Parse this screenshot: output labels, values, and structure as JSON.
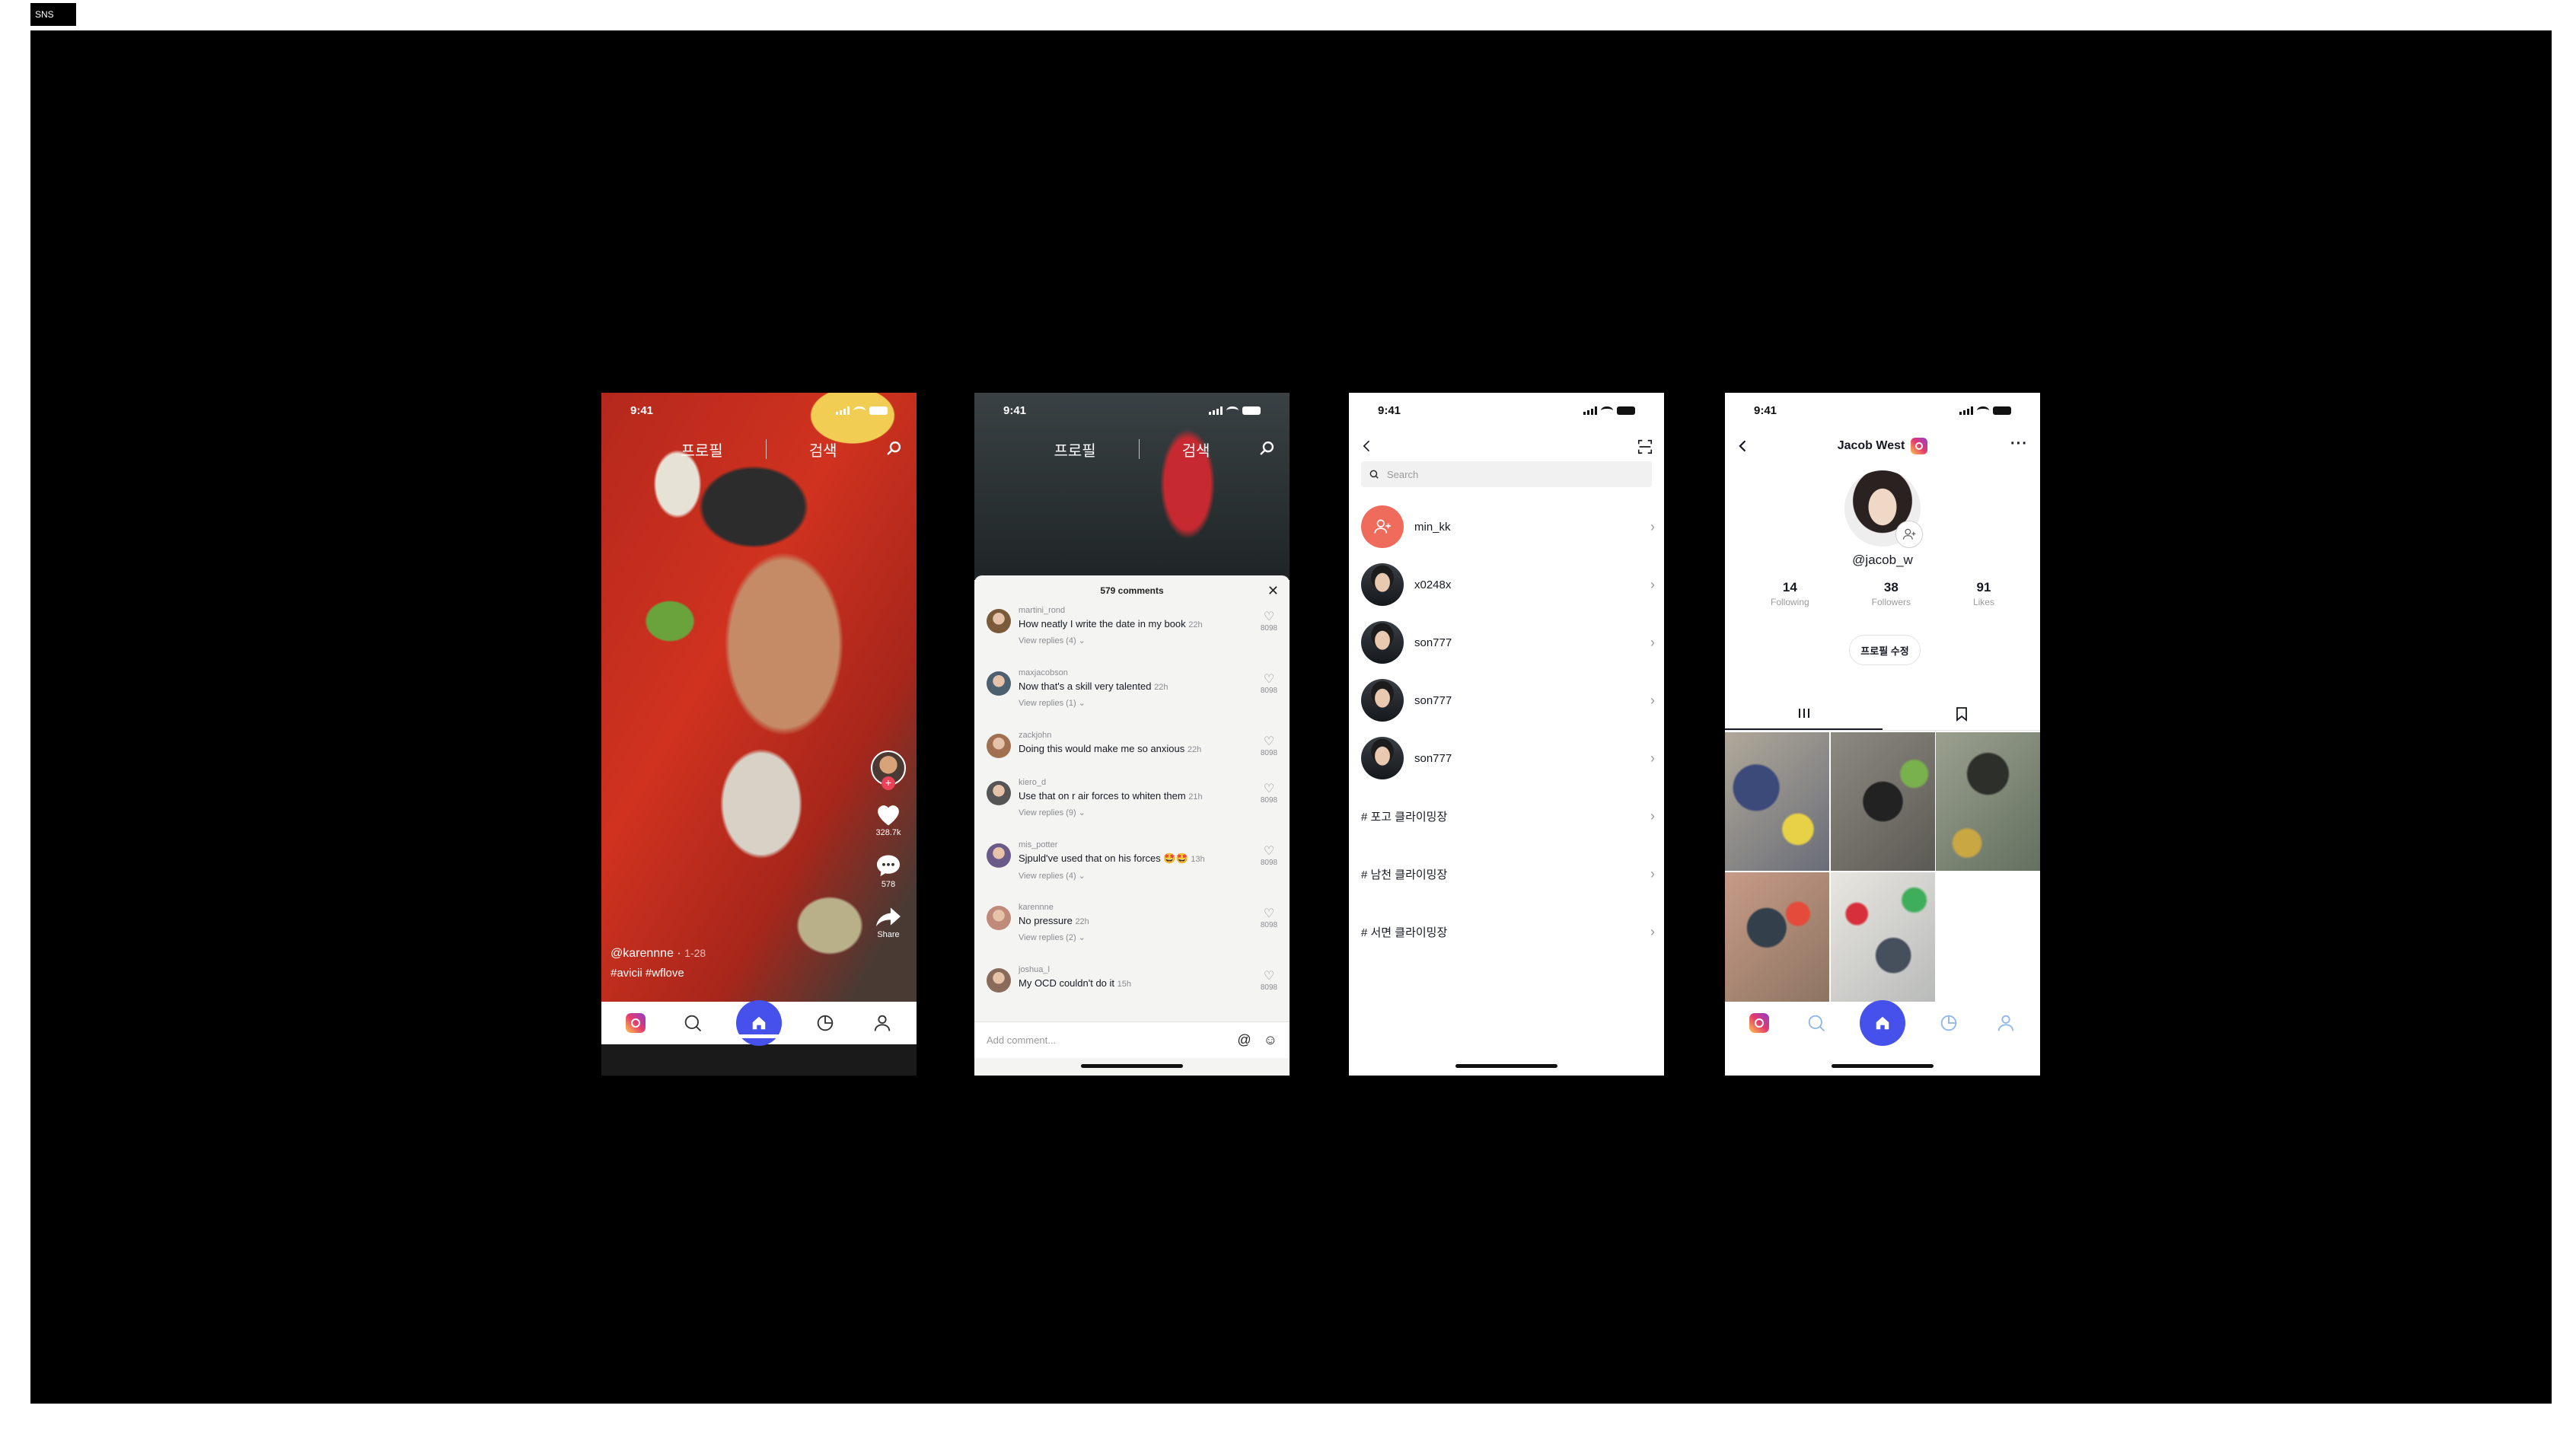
{
  "frame_label": "SNS",
  "status_time": "9:41",
  "feed": {
    "tabs": [
      "프로필",
      "검색"
    ],
    "username": "@karennne",
    "duration": "1-28",
    "hashtags": "#avicii #wflove",
    "likes": "328.7k",
    "comments": "578",
    "share": "Share"
  },
  "comments_sheet": {
    "tabs": [
      "프로필",
      "검색"
    ],
    "title": "579 comments",
    "add_placeholder": "Add comment...",
    "items": [
      {
        "user": "martini_rond",
        "text": "How neatly I write the date in my book",
        "ago": "22h",
        "replies": "View replies (4)",
        "likes": "8098",
        "color": "#7a5a3a"
      },
      {
        "user": "maxjacobson",
        "text": "Now that's a skill very talented",
        "ago": "22h",
        "replies": "View replies (1)",
        "likes": "8098",
        "color": "#4d6070"
      },
      {
        "user": "zackjohn",
        "text": "Doing this would make me so anxious",
        "ago": "22h",
        "replies": "",
        "likes": "8098",
        "color": "#a07050"
      },
      {
        "user": "kiero_d",
        "text": "Use that on r air forces to whiten them",
        "ago": "21h",
        "replies": "View replies (9)",
        "likes": "8098",
        "color": "#555555"
      },
      {
        "user": "mis_potter",
        "text": "Sjpuld've used that on his forces 🤩🤩",
        "ago": "13h",
        "replies": "View replies (4)",
        "likes": "8098",
        "color": "#6a5a8a"
      },
      {
        "user": "karennne",
        "text": "No pressure",
        "ago": "22h",
        "replies": "View replies (2)",
        "likes": "8098",
        "color": "#c08a7a"
      },
      {
        "user": "joshua_l",
        "text": "My OCD couldn't do it",
        "ago": "15h",
        "replies": "",
        "likes": "8098",
        "color": "#8a6a5a"
      }
    ]
  },
  "search": {
    "placeholder": "Search",
    "rows": [
      {
        "label": "min_kk",
        "kind": "add-user"
      },
      {
        "label": "x0248x",
        "kind": "user"
      },
      {
        "label": "son777",
        "kind": "user"
      },
      {
        "label": "son777",
        "kind": "user"
      },
      {
        "label": "son777",
        "kind": "user"
      },
      {
        "label": "# 포고 클라이밍장",
        "kind": "tag"
      },
      {
        "label": "# 남천 클라이밍장",
        "kind": "tag"
      },
      {
        "label": "# 서면 클라이밍장",
        "kind": "tag"
      }
    ]
  },
  "profile": {
    "name": "Jacob West",
    "handle": "@jacob_w",
    "stats": [
      {
        "value": "14",
        "label": "Following"
      },
      {
        "value": "38",
        "label": "Followers"
      },
      {
        "value": "91",
        "label": "Likes"
      }
    ],
    "edit_label": "프로필 수정"
  },
  "colors": {
    "accent": "#4551ea",
    "like_red": "#ea4359",
    "add_user": "#ef6b5b"
  }
}
